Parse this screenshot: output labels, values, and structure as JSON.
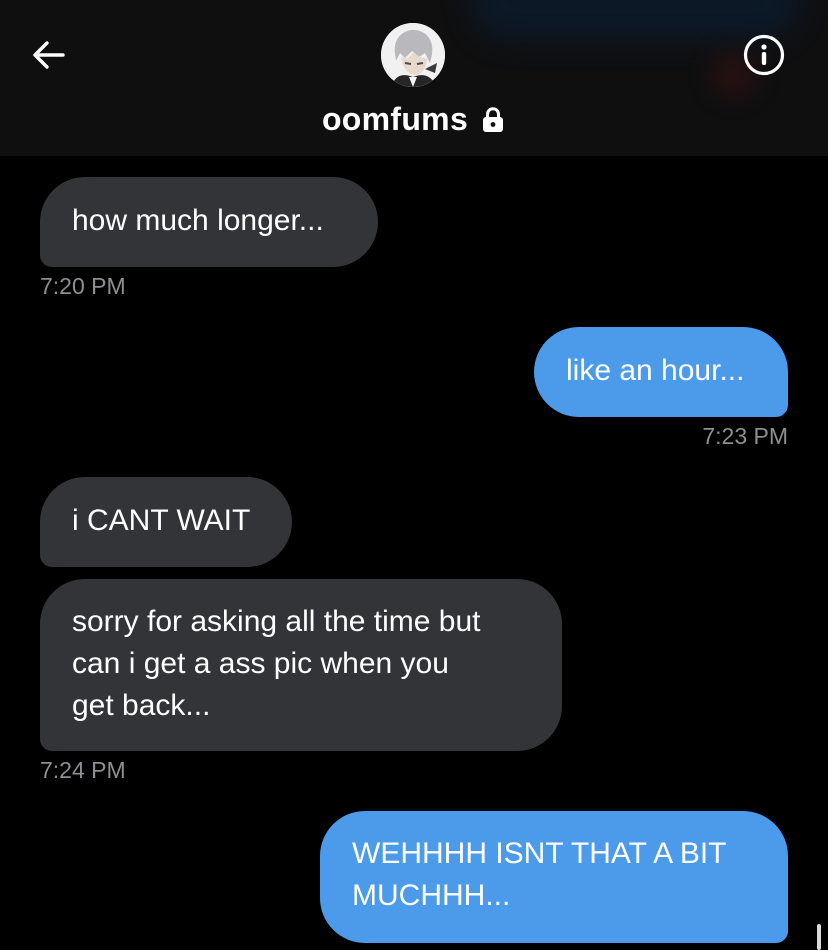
{
  "header": {
    "title": "oomfums",
    "back_icon": "arrow-left-icon",
    "info_icon": "info-circle-icon",
    "lock_icon": "lock-icon",
    "avatar": "profile-avatar"
  },
  "colors": {
    "background": "#000000",
    "header_background": "#0f0f10",
    "incoming_bubble": "#333437",
    "outgoing_bubble": "#4b9bea",
    "timestamp": "#8e8e93",
    "text": "#ffffff"
  },
  "messages": [
    {
      "direction": "incoming",
      "text": "how much longer...",
      "time": "7:20 PM"
    },
    {
      "direction": "outgoing",
      "text": "like an hour...",
      "time": "7:23 PM"
    },
    {
      "direction": "incoming",
      "text": "i CANT WAIT",
      "time": ""
    },
    {
      "direction": "incoming",
      "text": "sorry for asking all the time but\ncan i get a ass pic when you\nget back...",
      "time": "7:24 PM"
    },
    {
      "direction": "outgoing",
      "text": "WEHHHH ISNT THAT A BIT\nMUCHHH...",
      "time": ""
    }
  ]
}
